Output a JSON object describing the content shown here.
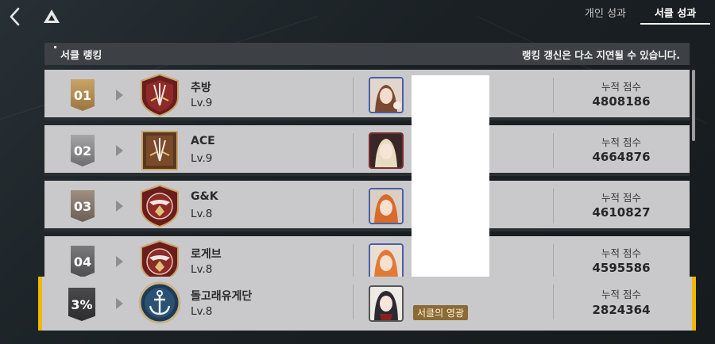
{
  "nav": {
    "back_icon": "chevron-left-icon",
    "logo_icon": "game-logo-icon"
  },
  "tabs": [
    {
      "label": "개인 성과",
      "active": false
    },
    {
      "label": "서클 성과",
      "active": true
    }
  ],
  "header": {
    "title": "서클 랭킹",
    "note": "랭킹 갱신은 다소 지연될 수 있습니다."
  },
  "rankings": [
    {
      "rank": "01",
      "name": "추방",
      "level": "Lv.9",
      "score_label": "누적 점수",
      "score": "4808186",
      "rank_color": "#b08a4a"
    },
    {
      "rank": "02",
      "name": "ACE",
      "level": "Lv.9",
      "score_label": "누적 점수",
      "score": "4664876",
      "rank_color": "#8d8d90"
    },
    {
      "rank": "03",
      "name": "G&K",
      "level": "Lv.8",
      "score_label": "누적 점수",
      "score": "4610827",
      "rank_color": "#8a7d72"
    },
    {
      "rank": "04",
      "name": "로게브",
      "level": "Lv.8",
      "score_label": "누적 점수",
      "score": "4595586",
      "rank_color": "#6f6f72"
    }
  ],
  "own": {
    "rank": "3%",
    "name": "돌고래유게단",
    "level": "Lv.8",
    "badge": "서클의 영광",
    "score_label": "누적 점수",
    "score": "2824364",
    "rank_color": "#3d3d3f",
    "accent": "#f2b700"
  }
}
